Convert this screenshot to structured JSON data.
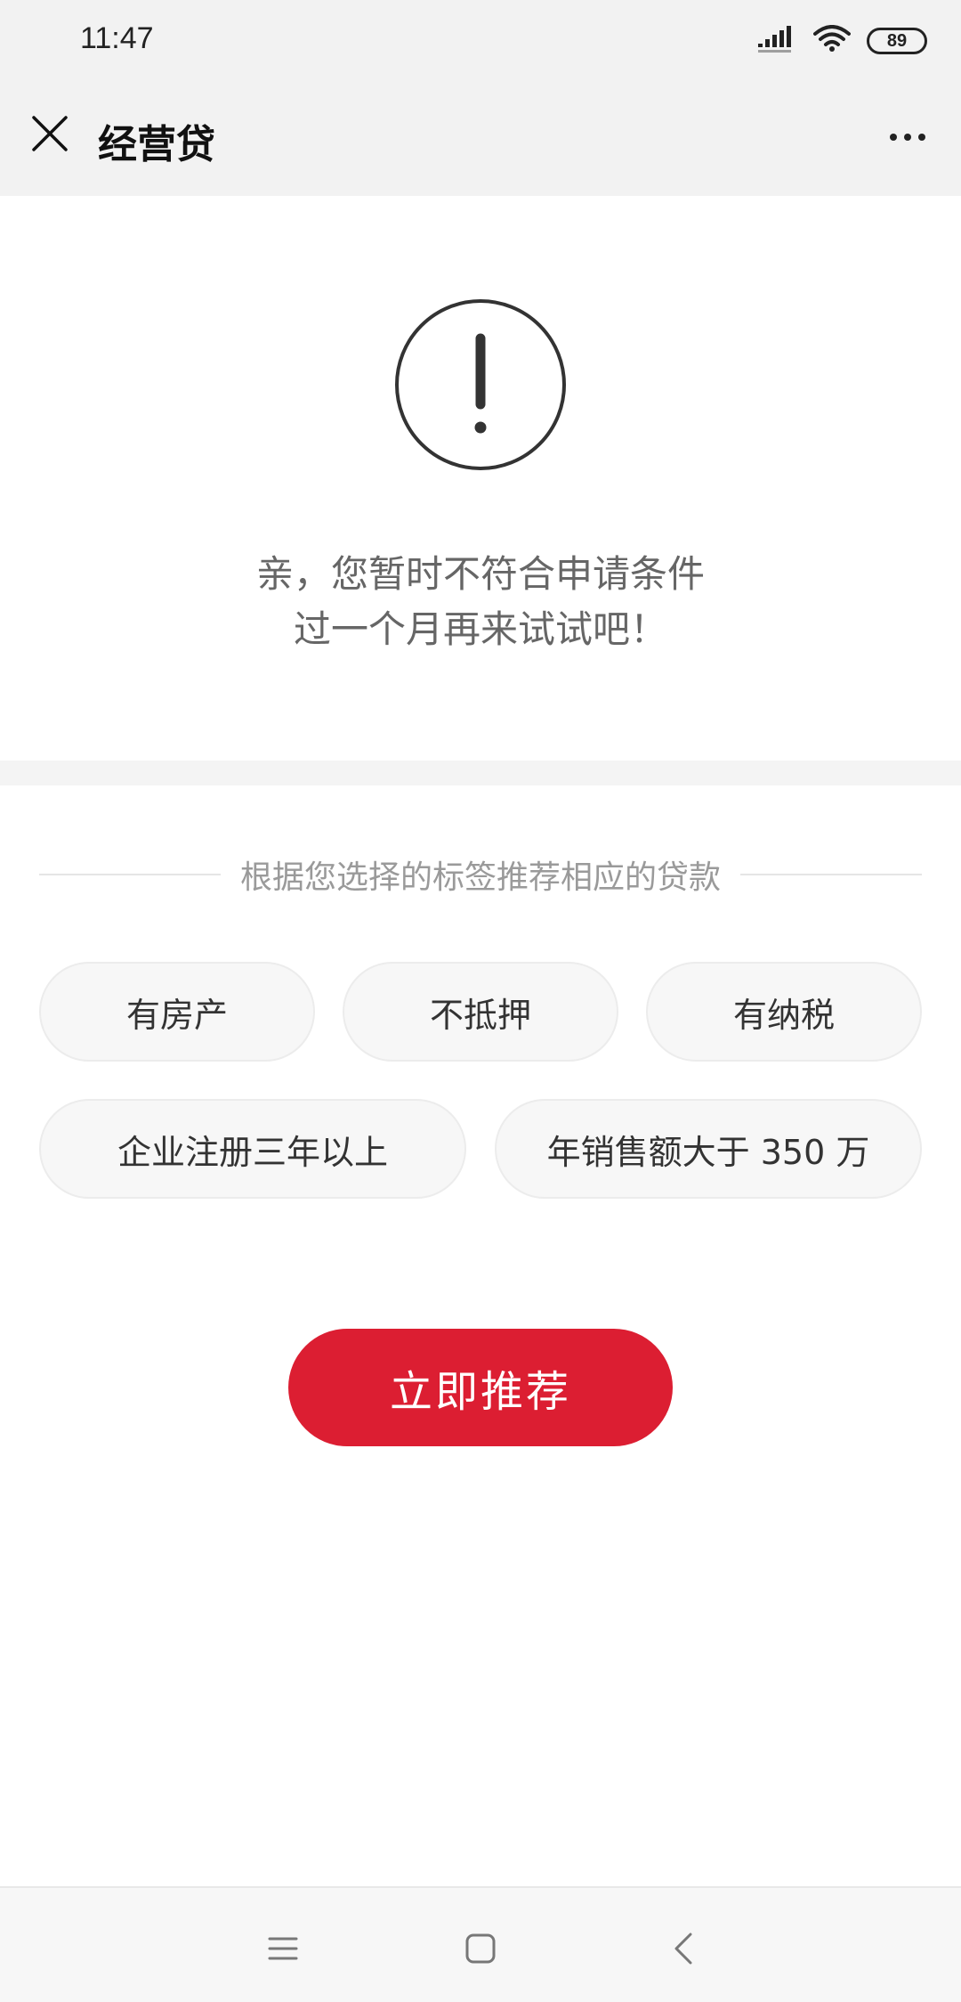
{
  "status_bar": {
    "time": "11:47",
    "battery": "89",
    "icons": [
      "signal-icon",
      "wifi-icon",
      "battery-icon"
    ]
  },
  "header": {
    "title": "经营贷",
    "close_icon": "close-icon",
    "more_icon": "more-icon"
  },
  "result": {
    "icon": "alert-icon",
    "line1": "亲，您暂时不符合申请条件",
    "line2": "过一个月再来试试吧！"
  },
  "recommend": {
    "header": "根据您选择的标签推荐相应的贷款",
    "tags": [
      "有房产",
      "不抵押",
      "有纳税",
      "企业注册三年以上",
      "年销售额大于 350 万"
    ],
    "button_label": "立即推荐"
  },
  "nav_bar": {
    "icons": [
      "menu-icon",
      "home-icon",
      "back-icon"
    ]
  },
  "colors": {
    "accent": "#dc1e32",
    "header_bg": "#f2f2f2"
  }
}
